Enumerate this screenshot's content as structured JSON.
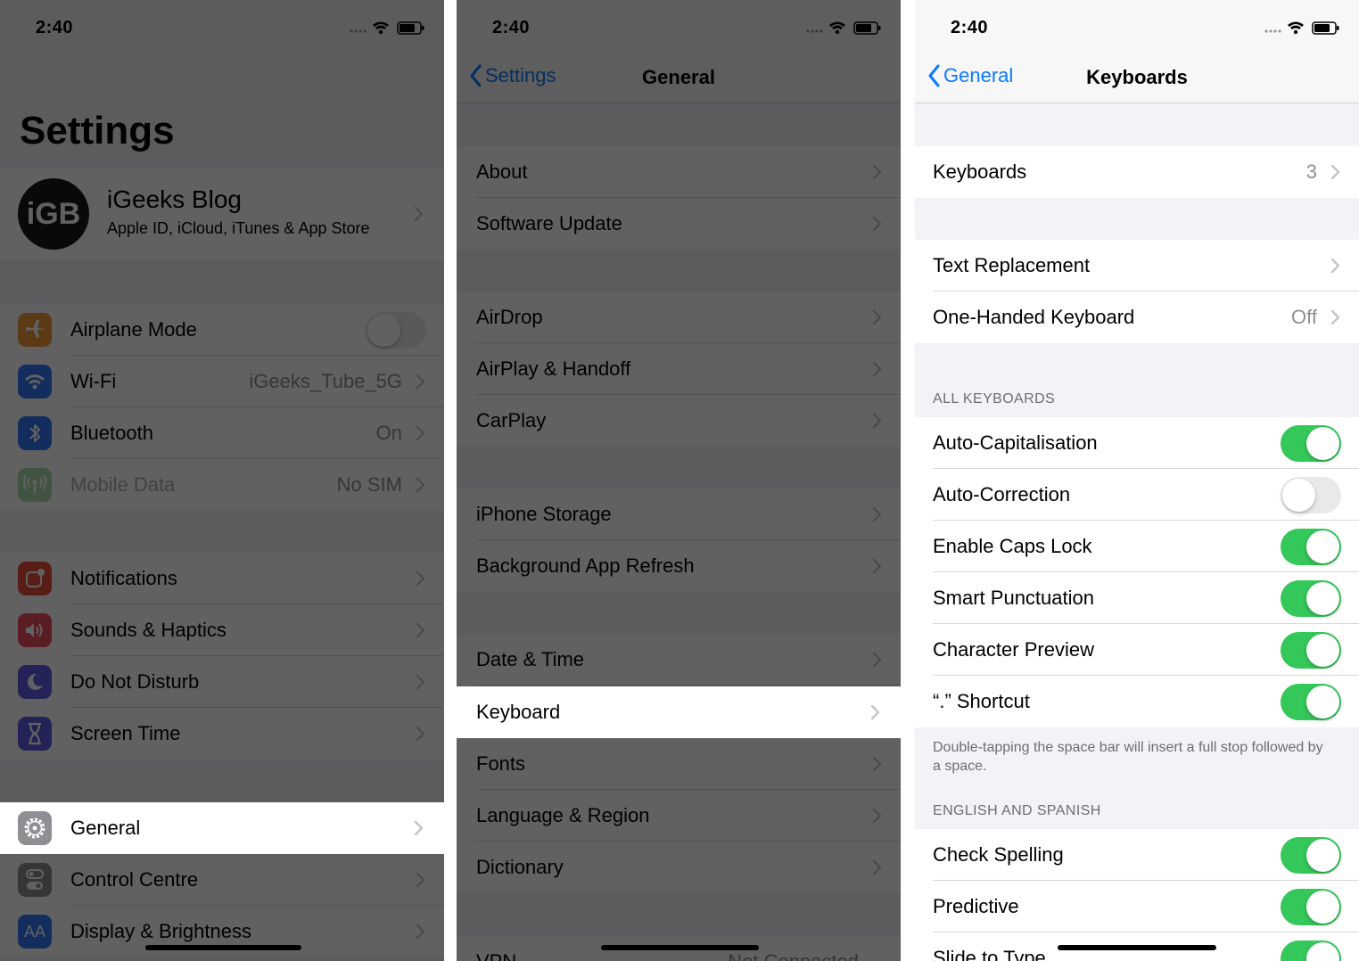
{
  "status_bar": {
    "time": "2:40"
  },
  "panel1": {
    "title": "Settings",
    "profile": {
      "avatar_text": "iGB",
      "name": "iGeeks Blog",
      "subtitle": "Apple ID, iCloud, iTunes & App Store"
    },
    "group1": [
      {
        "label": "Airplane Mode",
        "icon": "airplane-icon",
        "color": "#f09a37",
        "toggle": false
      },
      {
        "label": "Wi-Fi",
        "icon": "wifi-icon",
        "color": "#3478f6",
        "value": "iGeeks_Tube_5G"
      },
      {
        "label": "Bluetooth",
        "icon": "bluetooth-icon",
        "color": "#3478f6",
        "value": "On"
      },
      {
        "label": "Mobile Data",
        "icon": "antenna-icon",
        "color": "#65c466",
        "value": "No SIM",
        "dimmed": true
      }
    ],
    "group2": [
      {
        "label": "Notifications",
        "icon": "notifications-icon",
        "color": "#eb4d3d"
      },
      {
        "label": "Sounds & Haptics",
        "icon": "speaker-icon",
        "color": "#eb4e5e"
      },
      {
        "label": "Do Not Disturb",
        "icon": "moon-icon",
        "color": "#5e5ce6"
      },
      {
        "label": "Screen Time",
        "icon": "hourglass-icon",
        "color": "#5e5ce6"
      }
    ],
    "group3": [
      {
        "label": "General",
        "icon": "gear-icon",
        "color": "#8e8e93",
        "highlighted": true
      },
      {
        "label": "Control Centre",
        "icon": "control-centre-icon",
        "color": "#8e8e93"
      },
      {
        "label": "Display & Brightness",
        "icon": "display-icon",
        "color": "#3478f6",
        "icon_text": "AA"
      }
    ]
  },
  "panel2": {
    "back_label": "Settings",
    "title": "General",
    "groups": [
      [
        "About",
        "Software Update"
      ],
      [
        "AirDrop",
        "AirPlay & Handoff",
        "CarPlay"
      ],
      [
        "iPhone Storage",
        "Background App Refresh"
      ],
      [
        "Date & Time",
        "Keyboard",
        "Fonts",
        "Language & Region",
        "Dictionary"
      ]
    ],
    "highlighted": "Keyboard",
    "partial_row": {
      "label": "VPN",
      "value": "Not Connected"
    }
  },
  "panel3": {
    "back_label": "General",
    "title": "Keyboards",
    "keyboards_row": {
      "label": "Keyboards",
      "value": "3"
    },
    "group2": [
      {
        "label": "Text Replacement",
        "value": ""
      },
      {
        "label": "One-Handed Keyboard",
        "value": "Off"
      }
    ],
    "all_keyboards_header": "ALL KEYBOARDS",
    "all_keyboards": [
      {
        "label": "Auto-Capitalisation",
        "on": true
      },
      {
        "label": "Auto-Correction",
        "on": false
      },
      {
        "label": "Enable Caps Lock",
        "on": true
      },
      {
        "label": "Smart Punctuation",
        "on": true
      },
      {
        "label": "Character Preview",
        "on": true
      },
      {
        "label": "“.” Shortcut",
        "on": true
      }
    ],
    "shortcut_footer": "Double-tapping the space bar will insert a full stop followed by a space.",
    "language_header": "ENGLISH AND SPANISH",
    "language_rows": [
      {
        "label": "Check Spelling",
        "on": true
      },
      {
        "label": "Predictive",
        "on": true
      },
      {
        "label": "Slide to Type",
        "on": true
      }
    ]
  },
  "colors": {
    "accent": "#0a7aff",
    "toggle_on": "#34c759"
  }
}
